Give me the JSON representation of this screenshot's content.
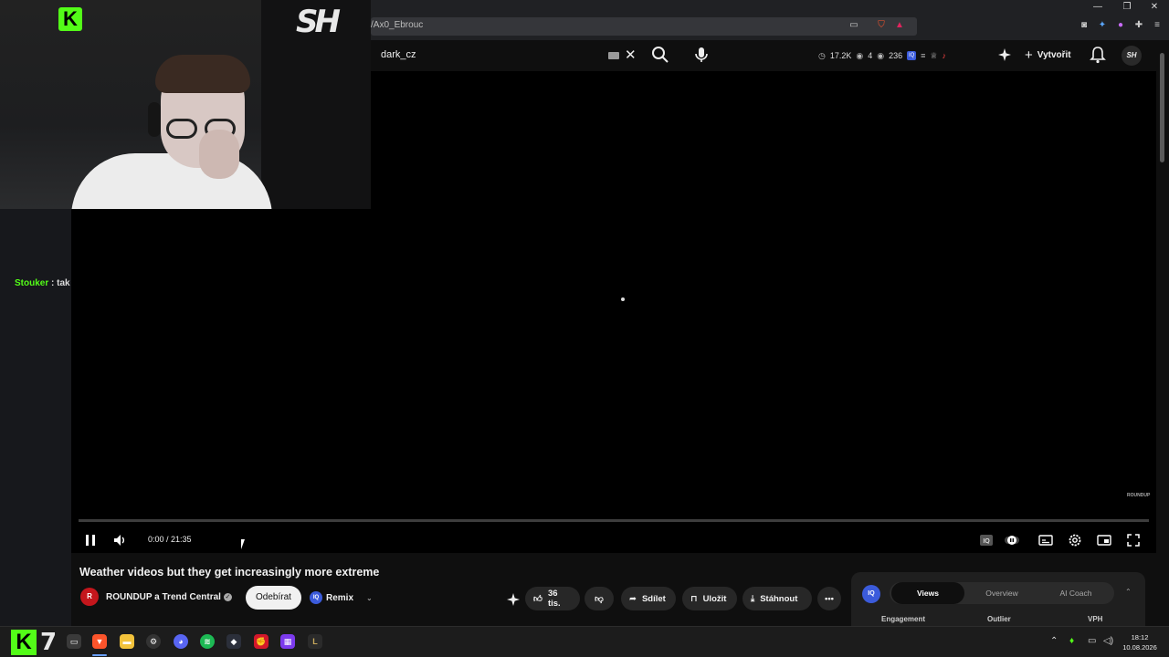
{
  "browser": {
    "address_text": "/Ax0_Ebrouc",
    "window_controls": [
      "—",
      "❐",
      "✕"
    ]
  },
  "masthead": {
    "search_value": "dark_cz",
    "stats": [
      {
        "icon": "clock-icon",
        "value": "17.2K"
      },
      {
        "icon": "eye-icon",
        "value": "4"
      },
      {
        "icon": "eye-icon",
        "value": "236"
      }
    ],
    "create_label": "Vytvořit",
    "channel_avatar_text": "SH"
  },
  "overlay": {
    "logo_text": "K",
    "brand_text": "SH",
    "chat": {
      "user": "Stouker",
      "message": " : tak"
    }
  },
  "player": {
    "time": "0:00 / 21:35",
    "watermark": "ROUNDUP",
    "progress": 0.0,
    "state": "paused-playing-icon"
  },
  "video": {
    "title": "Weather videos but they get increasingly more extreme",
    "channel": "ROUNDUP a Trend Central",
    "avatar_text": "R",
    "subscribe_label": "Odebírat",
    "remix_label": "Remix",
    "likes": "36 tis.",
    "share_label": "Sdílet",
    "save_label": "Uložit",
    "download_label": "Stáhnout"
  },
  "vidiq": {
    "logo_text": "IQ",
    "tabs": [
      "Views",
      "Overview",
      "AI Coach"
    ],
    "active_tab": "Views",
    "columns": [
      "Engagement",
      "Outlier",
      "VPH"
    ]
  },
  "taskbar": {
    "start_logo": "K",
    "seven": "7",
    "clock_time": "18:12",
    "clock_date": "10.08.2026"
  },
  "colors": {
    "kick_green": "#53fc18",
    "vidiq_blue": "#3b5bdb",
    "youtube_bg": "#0f0f0f"
  }
}
